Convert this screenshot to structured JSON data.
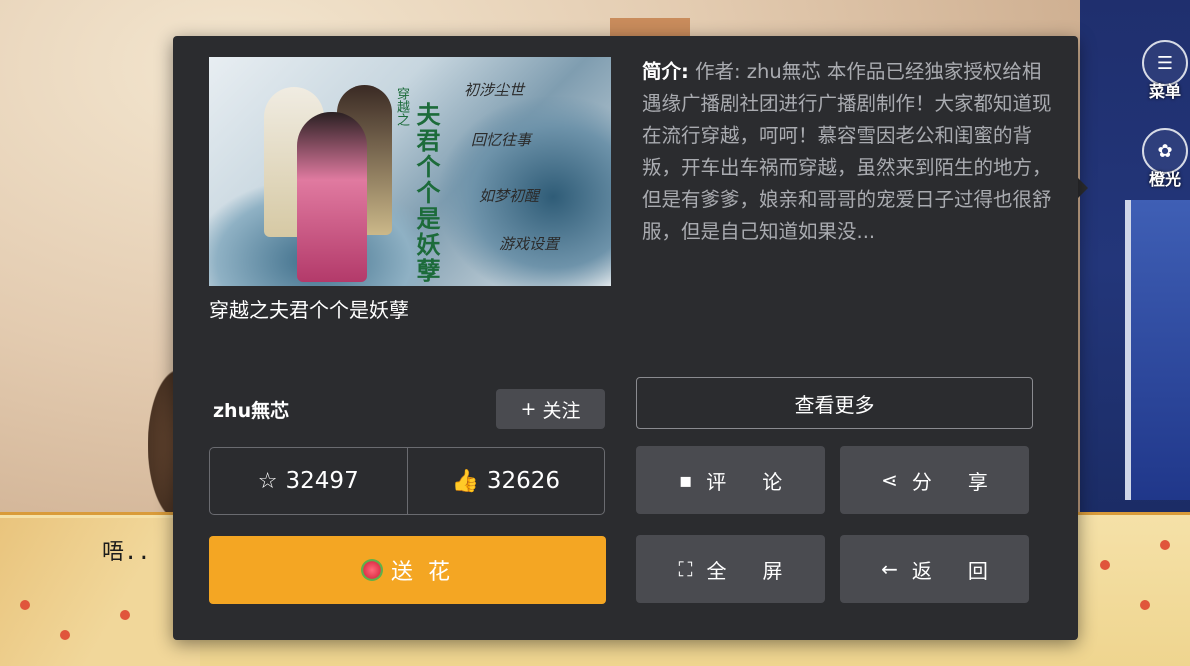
{
  "scene": {
    "dialogue": "唔.."
  },
  "side_menu": {
    "menu_label": "菜单",
    "light_label": "橙光",
    "menu_icon": "list-icon",
    "light_icon": "orange-light-icon"
  },
  "book": {
    "title": "穿越之夫君个个是妖孽",
    "cover": {
      "vertical_title": "夫君个个是妖孽",
      "vertical_prefix": "穿越之",
      "menu_items": [
        "初涉尘世",
        "回忆往事",
        "如梦初醒",
        "游戏设置"
      ]
    },
    "intro_label": "简介:",
    "intro_text": "作者: zhu無芯 本作品已经独家授权给相遇缘广播剧社团进行广播剧制作！大家都知道现在流行穿越，呵呵！慕容雪因老公和闺蜜的背叛，开车出车祸而穿越，虽然来到陌生的地方，但是有爹爹，娘亲和哥哥的宠爱日子过得也很舒服，但是自己知道如果没..."
  },
  "author": {
    "name": "zhu無芯",
    "follow_label": "关注",
    "follow_icon": "plus-icon"
  },
  "stats": {
    "favorites": "32497",
    "likes": "32626",
    "favorite_icon": "star-icon",
    "like_icon": "thumbs-up-icon"
  },
  "actions": {
    "send_flower": "送 花",
    "more": "查看更多",
    "comment": "评论",
    "share": "分享",
    "fullscreen": "全屏",
    "back": "返回"
  },
  "colors": {
    "panel_bg": "#2b2c2f",
    "flower_button": "#f4a623",
    "action_button": "#4a4b50"
  }
}
